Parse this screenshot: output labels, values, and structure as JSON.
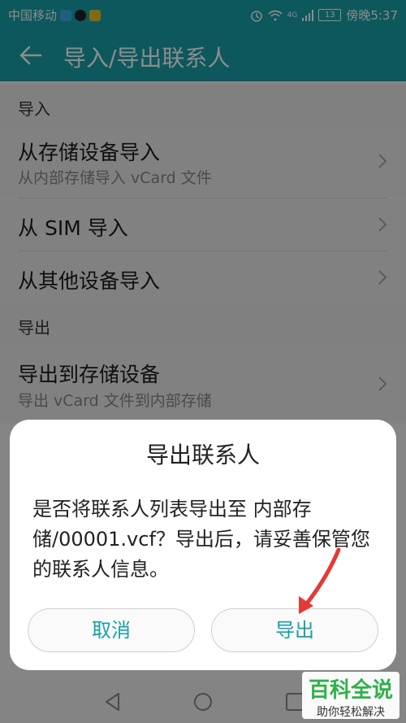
{
  "status": {
    "carrier": "中国移动",
    "network": "4G",
    "battery": "13",
    "time": "傍晚5:37"
  },
  "header": {
    "title": "导入/导出联系人"
  },
  "import_section": {
    "label": "导入",
    "items": [
      {
        "title": "从存储设备导入",
        "subtitle": "从内部存储导入 vCard 文件"
      },
      {
        "title": "从 SIM 导入"
      },
      {
        "title": "从其他设备导入"
      }
    ]
  },
  "export_section": {
    "label": "导出",
    "items": [
      {
        "title": "导出到存储设备",
        "subtitle": "导出 vCard 文件到内部存储"
      }
    ]
  },
  "dialog": {
    "title": "导出联系人",
    "message": "是否将联系人列表导出至 内部存储/00001.vcf？导出后，请妥善保管您的联系人信息。",
    "cancel_label": "取消",
    "confirm_label": "导出"
  },
  "watermark": {
    "line1": "百科全说",
    "line2": "助你轻松解决"
  },
  "colors": {
    "accent": "#17a0aa",
    "annotation": "#e53935"
  }
}
